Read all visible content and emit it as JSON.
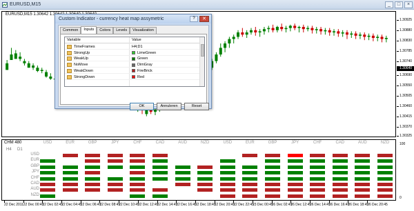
{
  "window": {
    "title": "EURUSD,M15",
    "info": "EURUSD,M15  1.30642 1.30642 1.30640 1.30640",
    "controls": [
      "_",
      "□",
      "×"
    ]
  },
  "price_axis": {
    "ticks": [
      "1.30925",
      "1.30880",
      "1.30830",
      "1.30785",
      "1.30740",
      "1.30690",
      "1.30550",
      "1.30505",
      "1.30460",
      "1.30415",
      "1.30370",
      "1.30325"
    ],
    "current_price": "1.30640"
  },
  "dialog": {
    "title": "Custom Indicator - currency heat map assymetric",
    "help": "?",
    "close": "✕",
    "tabs": [
      "Common",
      "Inputs",
      "Colors",
      "Levels",
      "Visualization"
    ],
    "active_tab": "Inputs",
    "columns": {
      "variable": "Variable",
      "value": "Value"
    },
    "rows": [
      {
        "variable": "TimeFrames",
        "value": "H4;D1",
        "swatch": null
      },
      {
        "variable": "StrongUp",
        "value": "LimeGreen",
        "swatch": "#32cd32"
      },
      {
        "variable": "WeakUp",
        "value": "Green",
        "swatch": "#008000"
      },
      {
        "variable": "NoMove",
        "value": "DimGray",
        "swatch": "#696969"
      },
      {
        "variable": "WeakDown",
        "value": "FireBrick",
        "swatch": "#b22222"
      },
      {
        "variable": "StrongDown",
        "value": "Red",
        "swatch": "#ff0000"
      }
    ],
    "buttons": {
      "ok": "OK",
      "cancel": "Annuleren",
      "reset": "Reset"
    }
  },
  "heatmap": {
    "name": "CHM 480",
    "timeframes": [
      "H4",
      "D1"
    ],
    "rows": [
      "USD",
      "EUR",
      "GBP",
      "JPY",
      "CHF",
      "CAD",
      "AUD",
      "NZD"
    ],
    "columns": [
      "USD",
      "EUR",
      "GBP",
      "JPY",
      "CHF",
      "CAD",
      "AUD",
      "NZD",
      "USD",
      "EUR",
      "GBP",
      "JPY",
      "CHF",
      "CAD",
      "AUD",
      "NZD"
    ],
    "colors": {
      "strong_up": "#32cd32",
      "weak_up": "#008000",
      "no_move": "#696969",
      "weak_down": "#b22222",
      "strong_down": "#ff0000"
    },
    "cells": [
      [
        "",
        "wd",
        "wd",
        "wd",
        "wd",
        "wd",
        "",
        "",
        "",
        "wd",
        "wd",
        "sd",
        "wd",
        "wd",
        "wd",
        "wd"
      ],
      [
        "wu",
        "",
        "wd",
        "wd",
        "wd",
        "wu",
        "",
        "",
        "wu",
        "",
        "wu",
        "wu",
        "wu",
        "wu",
        "wu",
        "wu"
      ],
      [
        "wu",
        "wu",
        "wu",
        "wu",
        "wu",
        "wu",
        "wu",
        "wd",
        "wu",
        "wu",
        "wu",
        "wu",
        "wu",
        "wu",
        "wu",
        "wu"
      ],
      [
        "wu",
        "wu",
        "wd",
        "",
        "wd",
        "wu",
        "wu",
        "wu",
        "wu",
        "wu",
        "wu",
        "wu",
        "wu",
        "wu",
        "wu",
        "wu"
      ],
      [
        "wu",
        "wu",
        "wu",
        "wu",
        "wu",
        "wu",
        "wu",
        "wu",
        "wu",
        "wu",
        "wu",
        "wu",
        "wu",
        "wu",
        "wu",
        "wu"
      ],
      [
        "wd",
        "wd",
        "wd",
        "wd",
        "wd",
        "",
        "wd",
        "wd",
        "wd",
        "wd",
        "wd",
        "wd",
        "wd",
        "wd",
        "wd",
        "wd"
      ],
      [
        "wd",
        "wd",
        "wd",
        "wd",
        "wd",
        "wd",
        "",
        "wd",
        "wd",
        "wd",
        "wd",
        "wd",
        "wd",
        "wd",
        "wd",
        "wd"
      ],
      [
        "wu",
        "",
        "",
        "",
        "wu",
        "wu",
        "",
        "",
        "wd",
        "wd",
        "wd",
        "wd",
        "wd",
        "wd",
        "wd",
        "wd"
      ]
    ],
    "scale": [
      "100",
      "0"
    ]
  },
  "time_axis": [
    "22 Dec 2011",
    "22 Dec 00:45",
    "22 Dec 02:45",
    "22 Dec 04:45",
    "22 Dec 06:45",
    "22 Dec 08:45",
    "22 Dec 10:45",
    "22 Dec 12:45",
    "22 Dec 14:45",
    "22 Dec 16:45",
    "22 Dec 18:45",
    "22 Dec 20:45",
    "22 Dec 22:45",
    "23 Dec 00:45",
    "26 Dec 02:45",
    "26 Dec 12:45",
    "26 Dec 14:45",
    "26 Dec 16:45",
    "26 Dec 18:45",
    "26 Dec 20:45"
  ],
  "candles": [
    [
      56,
      65,
      62,
      60
    ],
    [
      65,
      76,
      70,
      72
    ],
    [
      66,
      74,
      71,
      66
    ],
    [
      66,
      72,
      68,
      64
    ],
    [
      62,
      66,
      64,
      60
    ],
    [
      58,
      64,
      62,
      58
    ],
    [
      58,
      62,
      60,
      56
    ],
    [
      55,
      60,
      58,
      54
    ],
    [
      55,
      58,
      56,
      53
    ],
    [
      50,
      56,
      54,
      49
    ],
    [
      48,
      53,
      50,
      47
    ],
    [
      48,
      52,
      48,
      45
    ],
    [
      46,
      50,
      47,
      44
    ],
    [
      45,
      48,
      46,
      43
    ],
    [
      44,
      47,
      45,
      43
    ],
    [
      43,
      46,
      45,
      42
    ],
    [
      42,
      46,
      44,
      40
    ],
    [
      40,
      45,
      42,
      38
    ],
    [
      39,
      42,
      41,
      36
    ],
    [
      38,
      41,
      40,
      35
    ],
    [
      36,
      41,
      38,
      34
    ],
    [
      34,
      40,
      36,
      33
    ],
    [
      34,
      37,
      35,
      31
    ],
    [
      32,
      36,
      33,
      30
    ],
    [
      32,
      34,
      33,
      28
    ],
    [
      28,
      34,
      30,
      26
    ],
    [
      30,
      33,
      28,
      26
    ],
    [
      26,
      30,
      28,
      24
    ],
    [
      24,
      28,
      26,
      22
    ],
    [
      26,
      28,
      24,
      20
    ],
    [
      20,
      26,
      22,
      18
    ],
    [
      22,
      24,
      20,
      16
    ],
    [
      16,
      24,
      22,
      14
    ],
    [
      22,
      26,
      18,
      16
    ],
    [
      18,
      22,
      20,
      15
    ],
    [
      20,
      24,
      22,
      18
    ],
    [
      22,
      26,
      24,
      20
    ],
    [
      24,
      28,
      27,
      22
    ],
    [
      27,
      30,
      28,
      25
    ],
    [
      28,
      32,
      30,
      26
    ],
    [
      30,
      35,
      33,
      28
    ],
    [
      33,
      36,
      35,
      31
    ],
    [
      35,
      40,
      38,
      34
    ],
    [
      38,
      44,
      42,
      37
    ],
    [
      42,
      48,
      46,
      40
    ],
    [
      46,
      55,
      53,
      45
    ],
    [
      53,
      60,
      58,
      50
    ],
    [
      58,
      66,
      64,
      56
    ],
    [
      64,
      72,
      70,
      62
    ],
    [
      70,
      80,
      76,
      68
    ],
    [
      76,
      82,
      80,
      72
    ],
    [
      80,
      86,
      84,
      76
    ],
    [
      84,
      88,
      86,
      80
    ],
    [
      86,
      92,
      90,
      84
    ],
    [
      90,
      94,
      88,
      86
    ],
    [
      88,
      92,
      90,
      85
    ],
    [
      90,
      94,
      92,
      88
    ],
    [
      92,
      95,
      90,
      87
    ],
    [
      90,
      93,
      91,
      86
    ],
    [
      91,
      95,
      93,
      88
    ],
    [
      93,
      96,
      94,
      90
    ],
    [
      94,
      97,
      92,
      90
    ],
    [
      92,
      96,
      95,
      90
    ],
    [
      95,
      98,
      93,
      91
    ],
    [
      93,
      96,
      94,
      90
    ],
    [
      94,
      97,
      96,
      91
    ],
    [
      96,
      98,
      94,
      92
    ],
    [
      94,
      96,
      95,
      90
    ],
    [
      95,
      97,
      93,
      90
    ],
    [
      93,
      96,
      94,
      91
    ],
    [
      94,
      96,
      92,
      89
    ],
    [
      92,
      95,
      93,
      89
    ],
    [
      93,
      95,
      91,
      88
    ],
    [
      91,
      94,
      92,
      88
    ],
    [
      92,
      94,
      90,
      87
    ],
    [
      90,
      93,
      91,
      87
    ],
    [
      91,
      93,
      89,
      86
    ],
    [
      89,
      92,
      90,
      86
    ],
    [
      90,
      92,
      88,
      84
    ],
    [
      88,
      91,
      89,
      85
    ],
    [
      89,
      91,
      87,
      84
    ],
    [
      87,
      90,
      88,
      84
    ],
    [
      88,
      90,
      86,
      83
    ],
    [
      86,
      89,
      87,
      83
    ],
    [
      87,
      89,
      85,
      82
    ],
    [
      85,
      88,
      86,
      82
    ],
    [
      86,
      88,
      84,
      81
    ],
    [
      84,
      87,
      85,
      81
    ]
  ]
}
